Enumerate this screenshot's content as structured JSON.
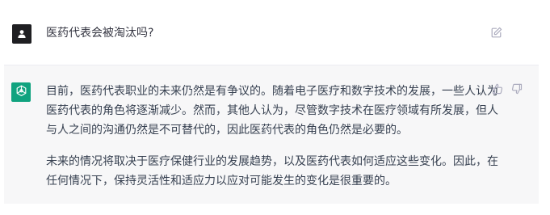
{
  "user_message": {
    "text": "医药代表会被淘汰吗?"
  },
  "assistant_message": {
    "paragraphs": [
      "目前，医药代表职业的未来仍然是有争议的。随着电子医疗和数字技术的发展，一些人认为",
      "医药代表的角色将逐渐减少。然而，其他人认为，尽管数字技术在医疗领域有所发展，但人",
      "与人之间的沟通仍然是不可替代的，因此医药代表的角色仍然是必要的。",
      "未来的情况将取决于医疗保健行业的发展趋势，以及医药代表如何适应这些变化。因此，在",
      "任何情况下，保持灵活性和适应力以应对可能发生的变化是很重要的。"
    ]
  },
  "icons": {
    "user_avatar": "user-icon",
    "assistant_avatar": "openai-logo-icon",
    "edit": "edit-icon",
    "thumbs_up": "thumbs-up-icon",
    "thumbs_down": "thumbs-down-icon"
  },
  "colors": {
    "assistant_avatar_bg": "#10a37f",
    "user_avatar_bg": "#1f1f22",
    "assistant_row_bg": "#f7f7f8"
  }
}
